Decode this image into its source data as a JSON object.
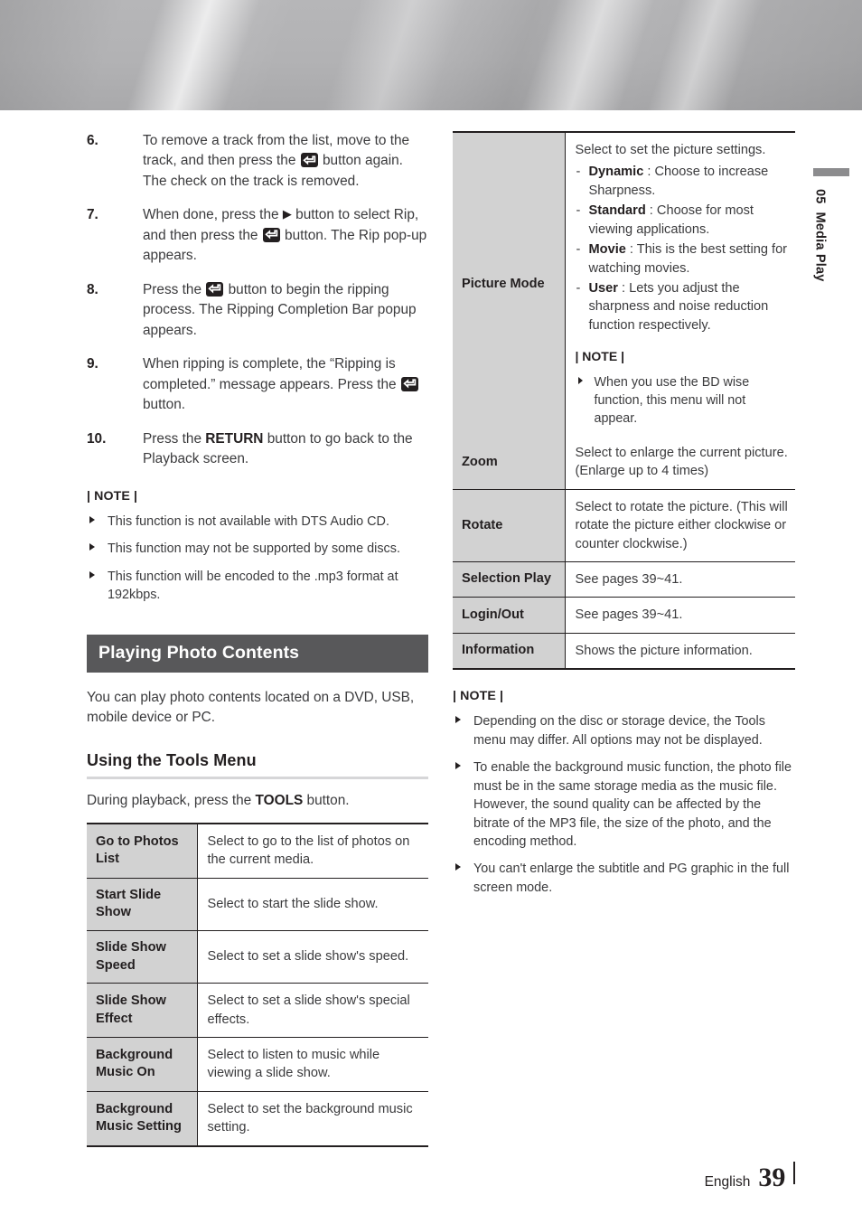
{
  "header": {
    "banner_color": "#b2b2b4"
  },
  "chapter_tab": {
    "number": "05",
    "title": "Media Play",
    "bar_color": "#8c8c8e"
  },
  "left_column": {
    "steps": [
      {
        "num": "6.",
        "parts": [
          {
            "t": "text",
            "v": "To remove a track from the list, move to the track, and then press the "
          },
          {
            "t": "enter-icon"
          },
          {
            "t": "text",
            "v": " button again. The check on the track is removed."
          }
        ]
      },
      {
        "num": "7.",
        "parts": [
          {
            "t": "text",
            "v": "When done, press the "
          },
          {
            "t": "play-glyph",
            "v": "▶"
          },
          {
            "t": "text",
            "v": " button to select Rip, and then press the "
          },
          {
            "t": "enter-icon"
          },
          {
            "t": "text",
            "v": " button. The Rip pop-up appears."
          }
        ]
      },
      {
        "num": "8.",
        "parts": [
          {
            "t": "text",
            "v": "Press the "
          },
          {
            "t": "enter-icon"
          },
          {
            "t": "text",
            "v": " button to begin the ripping process. The Ripping Completion Bar popup appears."
          }
        ]
      },
      {
        "num": "9.",
        "parts": [
          {
            "t": "text",
            "v": "When ripping is complete, the “Ripping is completed.” message appears. Press the "
          },
          {
            "t": "enter-icon"
          },
          {
            "t": "text",
            "v": " button."
          }
        ]
      },
      {
        "num": "10.",
        "parts": [
          {
            "t": "text",
            "v": "Press the "
          },
          {
            "t": "bold",
            "v": "RETURN"
          },
          {
            "t": "text",
            "v": " button to go back to the Playback screen."
          }
        ]
      }
    ],
    "note_title": "| NOTE |",
    "notes": [
      "This function is not available with DTS Audio CD.",
      "This function may not be supported by some discs.",
      "This function will be encoded to the .mp3 format at 192kbps."
    ],
    "section_heading": "Playing Photo Contents",
    "section_intro": "You can play photo contents located on a DVD, USB, mobile device or PC.",
    "sub_heading": "Using the Tools Menu",
    "sub_intro_parts": [
      {
        "t": "text",
        "v": "During playback, press the "
      },
      {
        "t": "bold",
        "v": "TOOLS"
      },
      {
        "t": "text",
        "v": " button."
      }
    ],
    "tools_table": [
      {
        "key": "Go to Photos List",
        "value": "Select to go to the list of photos on the current media."
      },
      {
        "key": "Start Slide Show",
        "value": "Select to start the slide show."
      },
      {
        "key": "Slide Show Speed",
        "value": "Select to set a slide show's speed."
      },
      {
        "key": "Slide Show Effect",
        "value": "Select to set a slide show's special effects."
      },
      {
        "key": "Background Music On",
        "value": "Select to listen to music while viewing a slide show."
      },
      {
        "key": "Background Music Setting",
        "value": "Select to set the background music setting."
      }
    ]
  },
  "right_column": {
    "picture_mode": {
      "key": "Picture Mode",
      "intro": "Select to set the picture settings.",
      "options": [
        {
          "name": "Dynamic",
          "desc": " : Choose to increase Sharpness."
        },
        {
          "name": "Standard",
          "desc": " : Choose for most viewing applications."
        },
        {
          "name": "Movie",
          "desc": " : This is the best setting for watching movies."
        },
        {
          "name": "User",
          "desc": " : Lets you adjust the sharpness and noise reduction function respectively."
        }
      ],
      "note_title": "| NOTE |",
      "note_items": [
        "When you use the BD wise function, this menu will not appear."
      ]
    },
    "rows": [
      {
        "key": "Zoom",
        "value": "Select to enlarge the current picture. (Enlarge up to 4 times)"
      },
      {
        "key": "Rotate",
        "value": "Select to rotate the picture. (This will rotate the picture either clockwise or counter clockwise.)"
      },
      {
        "key": "Selection Play",
        "value": "See pages 39~41."
      },
      {
        "key": "Login/Out",
        "value": "See pages 39~41."
      },
      {
        "key": "Information",
        "value": "Shows the picture information."
      }
    ],
    "note_title": "| NOTE |",
    "notes": [
      "Depending on the disc or storage device, the Tools menu may differ. All options may not be displayed.",
      "To enable the background music function, the photo file must be in the same storage media as the music file. However, the sound quality can be affected by the bitrate of the MP3 file, the size of the photo, and the encoding method.",
      "You can't enlarge the subtitle and PG graphic in the full screen mode."
    ]
  },
  "footer": {
    "language": "English",
    "page_number": "39"
  }
}
